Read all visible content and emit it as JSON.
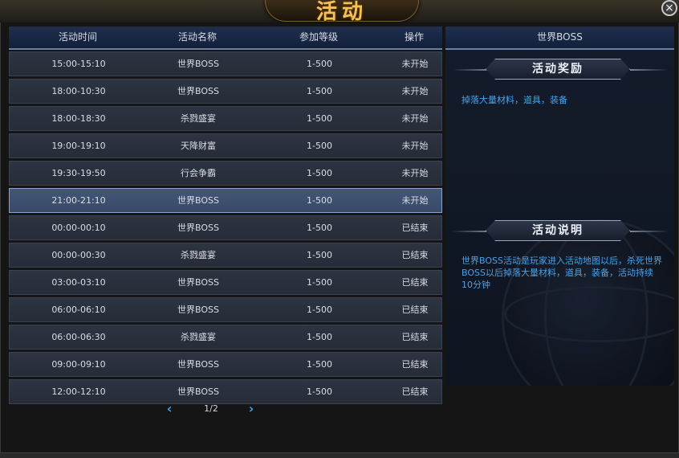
{
  "window": {
    "title": "活动",
    "close_label": "×"
  },
  "table": {
    "headers": {
      "time": "活动时间",
      "name": "活动名称",
      "level": "参加等级",
      "action": "操作"
    },
    "rows": [
      {
        "time": "15:00-15:10",
        "name": "世界BOSS",
        "level": "1-500",
        "status": "未开始"
      },
      {
        "time": "18:00-10:30",
        "name": "世界BOSS",
        "level": "1-500",
        "status": "未开始"
      },
      {
        "time": "18:00-18:30",
        "name": "杀戮盛宴",
        "level": "1-500",
        "status": "未开始"
      },
      {
        "time": "19:00-19:10",
        "name": "天降财富",
        "level": "1-500",
        "status": "未开始"
      },
      {
        "time": "19:30-19:50",
        "name": "行会争霸",
        "level": "1-500",
        "status": "未开始"
      },
      {
        "time": "21:00-21:10",
        "name": "世界BOSS",
        "level": "1-500",
        "status": "未开始"
      },
      {
        "time": "00:00-00:10",
        "name": "世界BOSS",
        "level": "1-500",
        "status": "已结束"
      },
      {
        "time": "00:00-00:30",
        "name": "杀戮盛宴",
        "level": "1-500",
        "status": "已结束"
      },
      {
        "time": "03:00-03:10",
        "name": "世界BOSS",
        "level": "1-500",
        "status": "已结束"
      },
      {
        "time": "06:00-06:10",
        "name": "世界BOSS",
        "level": "1-500",
        "status": "已结束"
      },
      {
        "time": "06:00-06:30",
        "name": "杀戮盛宴",
        "level": "1-500",
        "status": "已结束"
      },
      {
        "time": "09:00-09:10",
        "name": "世界BOSS",
        "level": "1-500",
        "status": "已结束"
      },
      {
        "time": "12:00-12:10",
        "name": "世界BOSS",
        "level": "1-500",
        "status": "已结束"
      }
    ]
  },
  "pager": {
    "text": "1/2",
    "prev_icon": "chevron-left-icon",
    "next_icon": "chevron-right-icon"
  },
  "detail": {
    "header": "世界BOSS",
    "reward_title": "活动奖励",
    "reward_text": "掉落大量材料，道具，装备",
    "desc_title": "活动说明",
    "desc_text": "世界BOSS活动是玩家进入活动地图以后，杀死世界BOSS以后掉落大量材料，道具，装备，活动持续10分钟"
  },
  "colors": {
    "accent_title": "#f2c25a",
    "link_blue": "#4aa2e8",
    "selected_row": "#435676"
  }
}
